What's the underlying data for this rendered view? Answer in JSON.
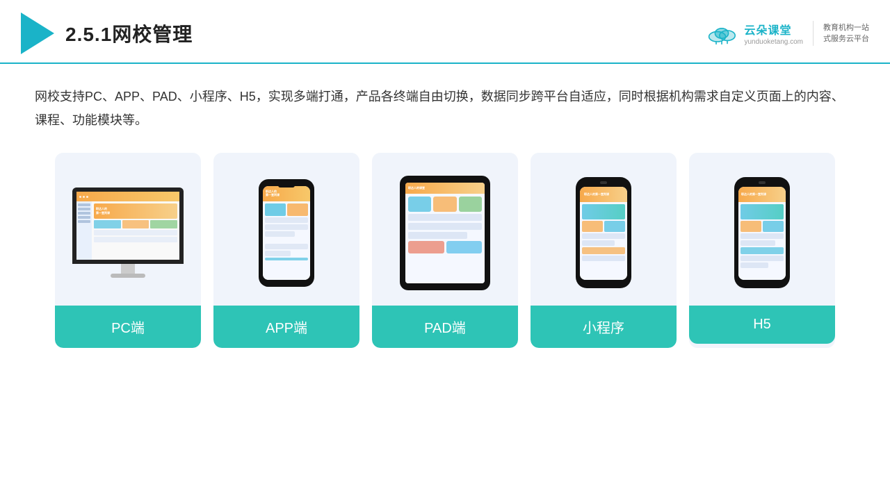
{
  "header": {
    "title": "2.5.1网校管理",
    "brand_name": "云朵课堂",
    "brand_domain": "yunduoketang.com",
    "brand_slogan": "教育机构一站\n式服务云平台"
  },
  "description": "网校支持PC、APP、PAD、小程序、H5，实现多端打通，产品各终端自由切换，数据同步跨平台自适应，同时根据机构需求自定义页面上的内容、课程、功能模块等。",
  "cards": [
    {
      "id": "pc",
      "label": "PC端"
    },
    {
      "id": "app",
      "label": "APP端"
    },
    {
      "id": "pad",
      "label": "PAD端"
    },
    {
      "id": "miniprogram",
      "label": "小程序"
    },
    {
      "id": "h5",
      "label": "H5"
    }
  ],
  "label_bg_color": "#2ec4b6"
}
